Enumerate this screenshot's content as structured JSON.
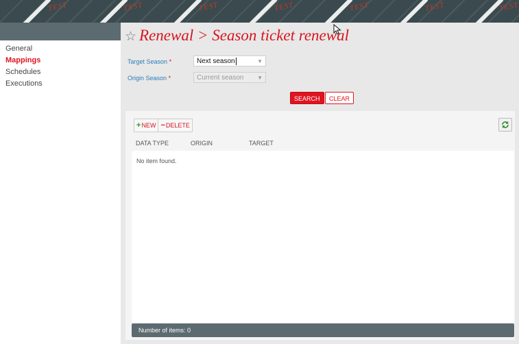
{
  "banner": {
    "watermark": "TEST"
  },
  "sidebar": {
    "items": [
      {
        "label": "General"
      },
      {
        "label": "Mappings"
      },
      {
        "label": "Schedules"
      },
      {
        "label": "Executions"
      }
    ]
  },
  "page": {
    "title": "Renewal > Season ticket renewal"
  },
  "form": {
    "target_season": {
      "label": "Target Season",
      "required_mark": "*",
      "value": "Next season"
    },
    "origin_season": {
      "label": "Origin Season",
      "required_mark": "*",
      "value": "Current season"
    }
  },
  "actions": {
    "search_label": "SEARCH",
    "clear_label": "CLEAR"
  },
  "toolbar": {
    "new_label": "NEW",
    "delete_label": "DELETE"
  },
  "table": {
    "columns": [
      "DATA TYPE",
      "ORIGIN",
      "TARGET"
    ],
    "empty_text": "No item found.",
    "footer_text": "Number of items: 0"
  },
  "colors": {
    "accent": "#e0141f",
    "link": "#2a7fb8",
    "footer_bg": "#5c6b70"
  }
}
